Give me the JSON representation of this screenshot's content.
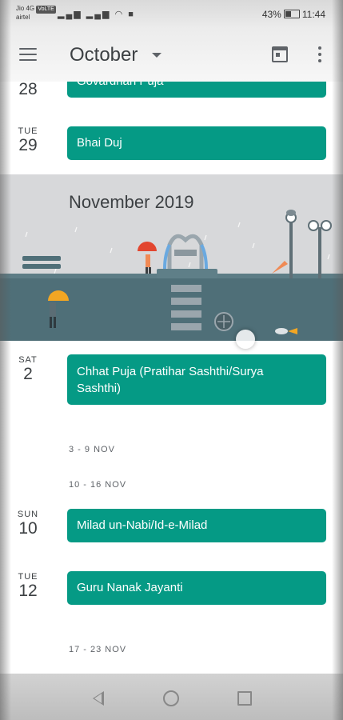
{
  "status_bar": {
    "carrier_line1": "Jio 4G",
    "volte_badge": "VoLTE",
    "carrier_line2": "airtel",
    "battery": "43%",
    "time": "11:44"
  },
  "app_bar": {
    "month": "October"
  },
  "agenda": [
    {
      "dow": "",
      "day": "28",
      "event": "Govardhan Puja"
    },
    {
      "dow": "TUE",
      "day": "29",
      "event": "Bhai Duj"
    }
  ],
  "banner": {
    "title": "November 2019"
  },
  "agenda2": [
    {
      "dow": "SAT",
      "day": "2",
      "event_line1": "Chhat Puja (Pratihar Sashthi/Surya",
      "event_line2": "Sashthi)"
    }
  ],
  "weeks": {
    "w1": "3 - 9 NOV",
    "w2": "10 - 16 NOV",
    "w3": "17 - 23 NOV"
  },
  "agenda3": [
    {
      "dow": "SUN",
      "day": "10",
      "event": "Milad un-Nabi/Id-e-Milad"
    },
    {
      "dow": "TUE",
      "day": "12",
      "event": "Guru Nanak Jayanti"
    }
  ],
  "colors": {
    "event_bg": "#059a85",
    "banner_water": "#4f6f78"
  }
}
